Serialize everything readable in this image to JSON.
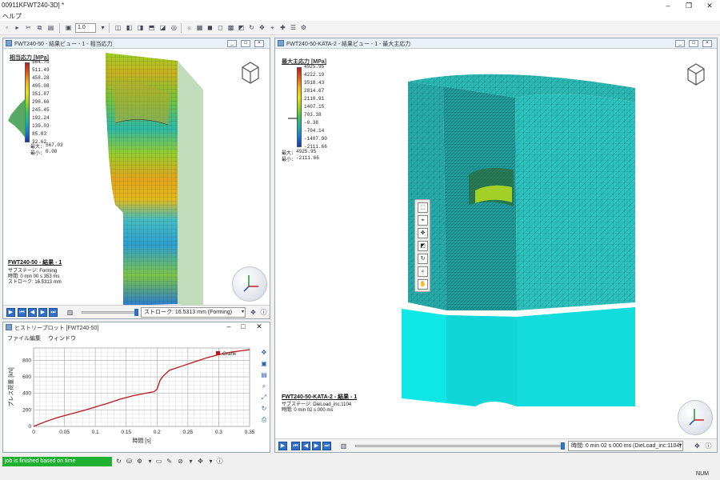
{
  "app": {
    "title": "00911KFWT240-3D] *",
    "menu_help": "ヘルプ",
    "zoom_value": "1.0",
    "status_message": "job is finished based on time",
    "status_num": "NUM"
  },
  "left_view": {
    "caption": "FWT240-50 - 結果ビュー - 1 - 相当応力",
    "legend_title": "相当応力 [MPa]",
    "ticks": [
      "564.70",
      "511.49",
      "458.28",
      "405.08",
      "351.87",
      "298.66",
      "245.45",
      "192.24",
      "139.03",
      "85.83",
      "32.62"
    ],
    "max_label": "最大:",
    "max_value": "567.03",
    "min_label": "最小:",
    "min_value": "0.00",
    "info_title": "FWT240-50 - 結果 - 1",
    "info_stage": "サブステージ: Forming",
    "info_time": "時間: 0 min 00 s 353 ms",
    "info_stroke": "ストローク: 16.5313 mm",
    "step_select": "ストローク: 16.5313 mm (Forming)"
  },
  "right_view": {
    "caption": "FWT240-50-KATA-2 - 結果ビュー - 1 - 最大主応力",
    "legend_title": "最大主応力 [MPa]",
    "ticks": [
      "4925.95",
      "4222.19",
      "3518.43",
      "2814.67",
      "2110.91",
      "1407.15",
      "703.38",
      "-0.38",
      "-704.14",
      "-1407.90",
      "-2111.66"
    ],
    "max_label": "最大:",
    "max_value": "4925.95",
    "min_label": "最小:",
    "min_value": "-2111.66",
    "info_title": "FWT240-50-KATA-2 - 結果 - 1",
    "info_stage": "サブステージ: DieLoad_inc:1104",
    "info_time": "時間: 0 min 02 s 000 ms",
    "step_select": "時間: 0 min 02 s 000 ms (DieLoad_inc:1104)"
  },
  "plot_window": {
    "caption": "ヒストリープロット [FWT240-50]",
    "menu": [
      "ファイル",
      "編集",
      "ウィンドウ"
    ]
  },
  "chart_data": {
    "type": "line",
    "title": "",
    "xlabel": "時間 [s]",
    "ylabel": "プレス荷重 [kN]",
    "xlim": [
      0,
      0.35
    ],
    "ylim": [
      0,
      950
    ],
    "xticks": [
      "0",
      "0.05",
      "0.1",
      "0.15",
      "0.2",
      "0.25",
      "0.3",
      "0.35"
    ],
    "yticks": [
      "0",
      "200",
      "400",
      "600",
      "800"
    ],
    "grid": true,
    "legend_position": "top-right",
    "series": [
      {
        "name": "Crank",
        "color": "#c0141a",
        "x": [
          0,
          0.02,
          0.04,
          0.06,
          0.08,
          0.1,
          0.12,
          0.14,
          0.16,
          0.18,
          0.195,
          0.2,
          0.205,
          0.21,
          0.22,
          0.24,
          0.26,
          0.28,
          0.3,
          0.32,
          0.34,
          0.35
        ],
        "y": [
          0,
          60,
          110,
          150,
          190,
          235,
          280,
          330,
          370,
          400,
          420,
          450,
          560,
          610,
          680,
          730,
          780,
          830,
          870,
          900,
          920,
          930
        ]
      }
    ]
  }
}
